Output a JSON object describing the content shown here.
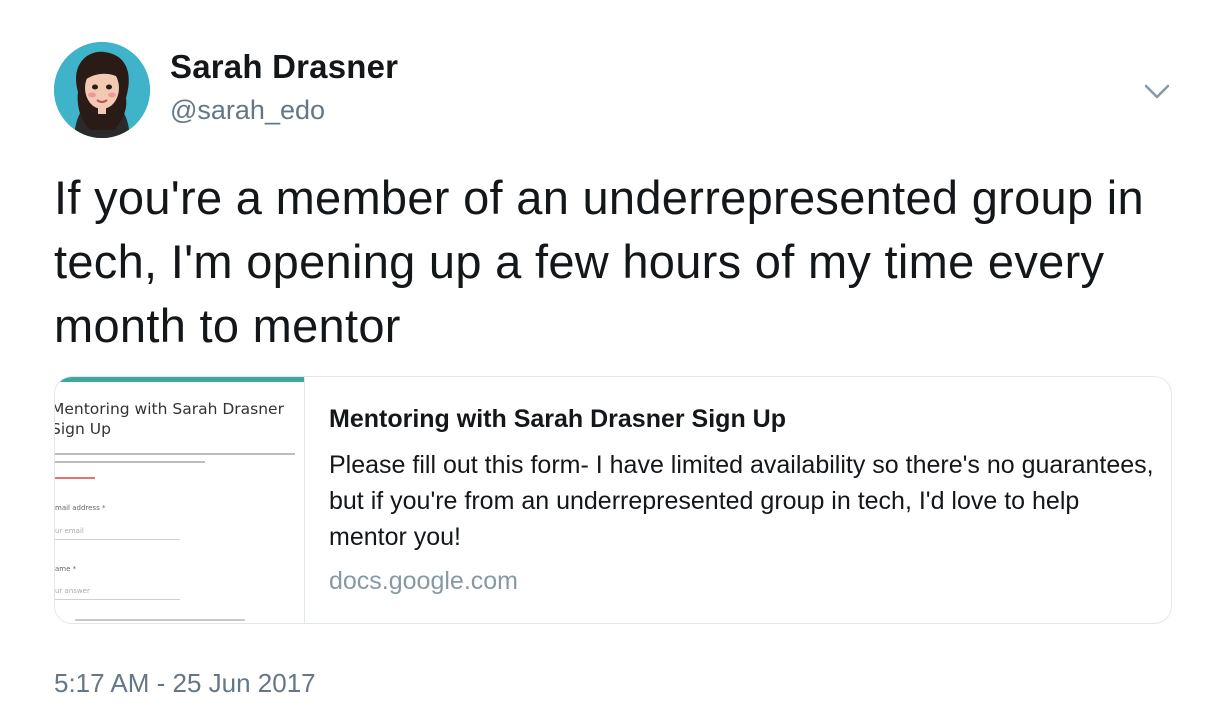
{
  "author": {
    "display_name": "Sarah Drasner",
    "handle": "@sarah_edo",
    "avatar_icon": "avatar-illustration-icon"
  },
  "menu_icon": "chevron-down-icon",
  "tweet": {
    "text": "If you're a member of an underrepresented group in tech, I'm opening up a few hours of my time every month to mentor"
  },
  "card": {
    "thumbnail": {
      "title": "Mentoring with Sarah Drasner Sign Up",
      "field_email": "mail address *",
      "field_email_placeholder": "ur email",
      "field_name": "ame *",
      "field_name_placeholder": "ur answer",
      "accent_color": "#3aa89a"
    },
    "title": "Mentoring with Sarah Drasner Sign Up",
    "description": "Please fill out this form- I have limited availability so there's no guarantees, but if you're from an underrepresented group in tech, I'd love to help mentor you!",
    "domain": "docs.google.com"
  },
  "timestamp": "5:17 AM - 25 Jun 2017",
  "colors": {
    "text": "#14171a",
    "secondary": "#657786",
    "domain": "#8899a6",
    "border": "#e1e8ed"
  }
}
